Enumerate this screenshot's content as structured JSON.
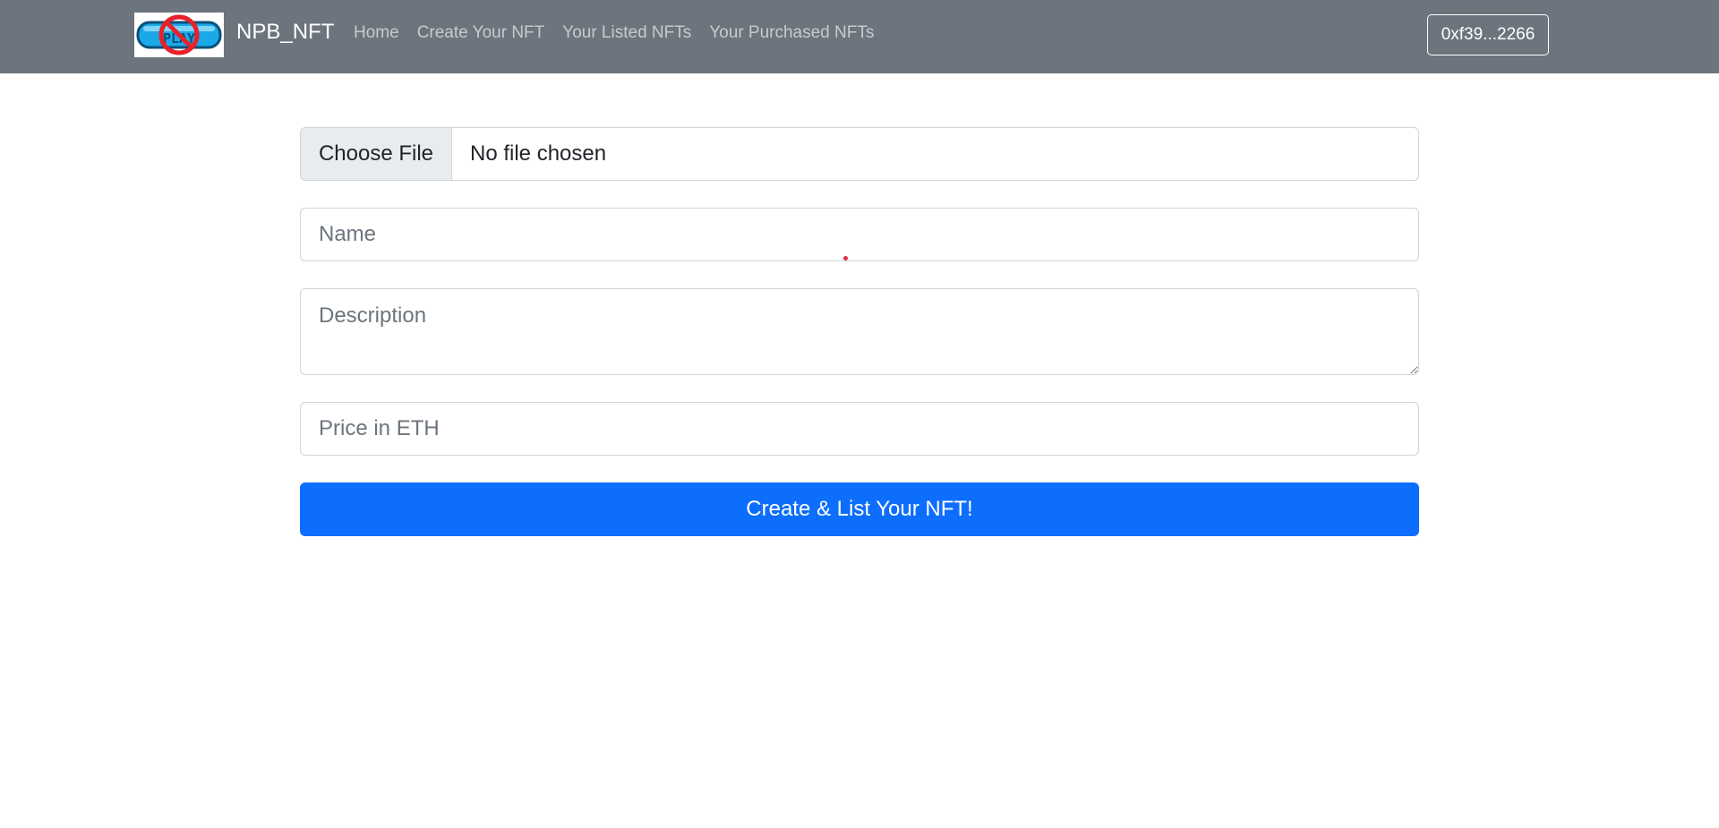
{
  "navbar": {
    "brand": "NPB_NFT",
    "logo_icon": "no-play-logo-icon",
    "links": [
      "Home",
      "Create Your NFT",
      "Your Listed NFTs",
      "Your Purchased NFTs"
    ],
    "account": "0xf39...2266"
  },
  "form": {
    "file_button": "Choose File",
    "file_status": "No file chosen",
    "name_placeholder": "Name",
    "description_placeholder": "Description",
    "price_placeholder": "Price in ETH",
    "submit_label": "Create & List Your NFT!"
  },
  "colors": {
    "navbar_bg": "#6c757d",
    "primary": "#0d6efd",
    "logo_blue": "#1aa9e8",
    "prohibition_red": "#e8202a"
  }
}
